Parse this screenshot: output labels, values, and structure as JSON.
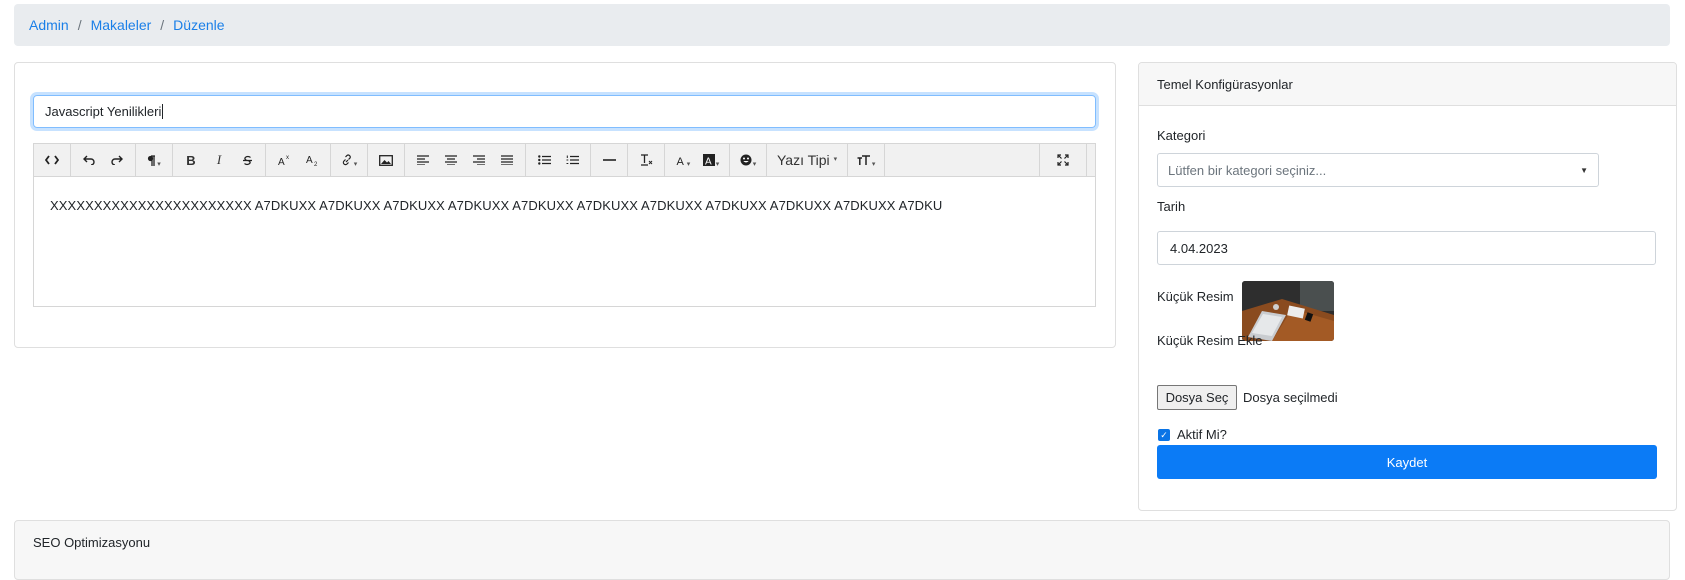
{
  "breadcrumb": {
    "items": [
      "Admin",
      "Makaleler",
      "Düzenle"
    ],
    "separator": "/"
  },
  "editor": {
    "title_value": "Javascript Yenilikleri",
    "toolbar": {
      "font_label": "Yazı Tipi",
      "buttons": [
        "code-view",
        "undo",
        "redo",
        "paragraph",
        "bold",
        "italic",
        "strikethrough",
        "superscript",
        "subscript",
        "link",
        "image",
        "align-left",
        "align-center",
        "align-right",
        "align-justify",
        "unordered-list",
        "ordered-list",
        "horizontal-rule",
        "clear-format",
        "font-color",
        "background-color",
        "emoji",
        "font-family",
        "font-size",
        "fullscreen"
      ]
    },
    "content": "XXXXXXXXXXXXXXXXXXXXXXX A7DKUXX A7DKUXX A7DKUXX A7DKUXX A7DKUXX A7DKUXX A7DKUXX A7DKUXX A7DKUXX A7DKUXX A7DKU"
  },
  "config": {
    "header": "Temel Konfigürasyonlar",
    "category_label": "Kategori",
    "category_placeholder": "Lütfen bir kategori seçiniz...",
    "date_label": "Tarih",
    "date_value": "4.04.2023",
    "thumbnail_label": "Küçük Resim",
    "add_thumbnail_label": "Küçük Resim Ekle",
    "file_button": "Dosya Seç",
    "file_status": "Dosya seçilmedi",
    "active_label": "Aktif Mi?",
    "active_checked": true,
    "save_label": "Kaydet"
  },
  "seo": {
    "header": "SEO Optimizasyonu"
  },
  "colors": {
    "primary": "#0b7bf6",
    "link": "#1a7fe8",
    "breadcrumb_bg": "#e9ecef"
  }
}
